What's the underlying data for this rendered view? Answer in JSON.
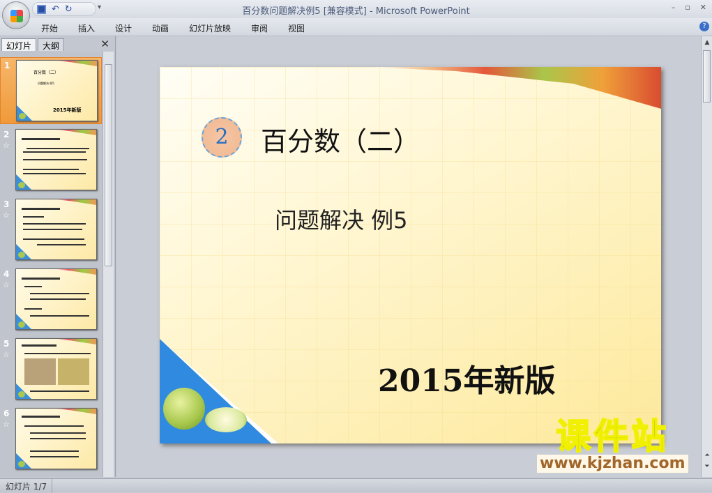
{
  "window": {
    "title": "百分数问题解决例5 [兼容模式] - Microsoft PowerPoint",
    "controls": [
      "–",
      "▫",
      "✕"
    ]
  },
  "qat": {
    "save": "save-icon",
    "undo": "↶",
    "redo": "↻",
    "more": "▾"
  },
  "ribbon": {
    "tabs": [
      "开始",
      "插入",
      "设计",
      "动画",
      "幻灯片放映",
      "审阅",
      "视图"
    ],
    "help": "?"
  },
  "pane": {
    "tabs": [
      "幻灯片",
      "大纲"
    ],
    "close": "✕"
  },
  "thumbnails": [
    {
      "num": "1",
      "selected": true
    },
    {
      "num": "2",
      "star": "☆"
    },
    {
      "num": "3",
      "star": "☆"
    },
    {
      "num": "4",
      "star": "☆"
    },
    {
      "num": "5",
      "star": "☆"
    },
    {
      "num": "6",
      "star": "☆"
    }
  ],
  "slide": {
    "badge": "2",
    "title": "百分数（二）",
    "subtitle": "问题解决  例5",
    "version": "2015年新版"
  },
  "thumb1": {
    "title": "百分数（二）",
    "subtitle": "问题解决 例5",
    "version": "2015年新版"
  },
  "watermark": {
    "cn": "课件站",
    "url": "www.kjzhan.com"
  },
  "status": {
    "slide": "幻灯片 1/7"
  },
  "colors": {
    "selection": "#ef9a3a",
    "accent": "#2f8ae0"
  }
}
